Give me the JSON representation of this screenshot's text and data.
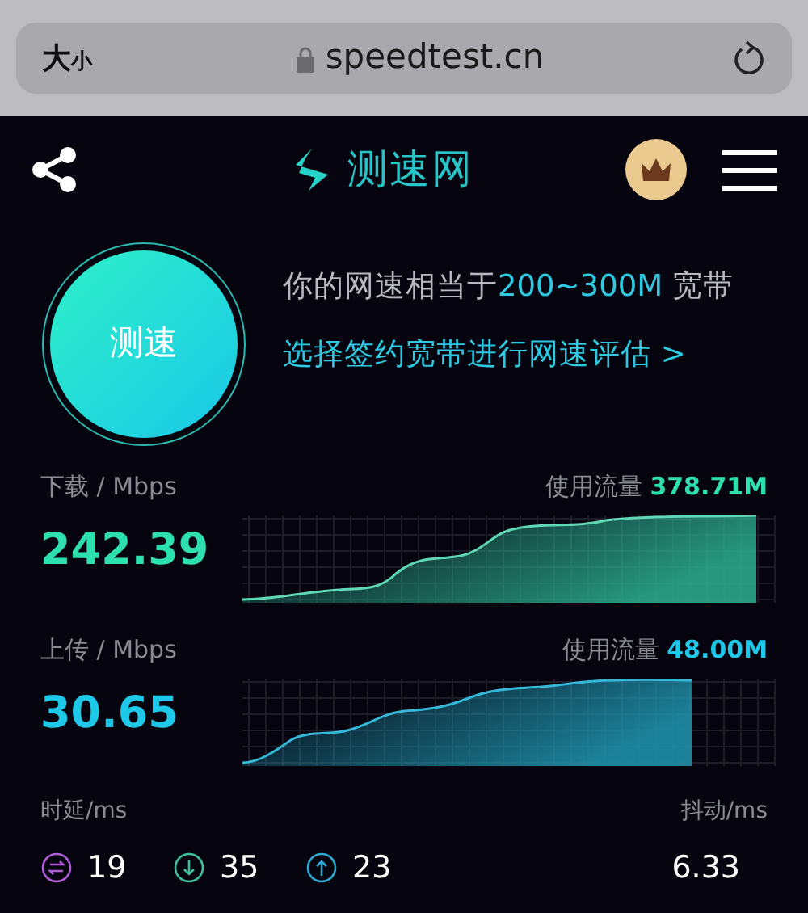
{
  "browser_bar": {
    "text_size": {
      "large": "大",
      "small": "小"
    },
    "url": "speedtest.cn"
  },
  "header": {
    "logo_text": "测速网"
  },
  "test_button": {
    "label": "测速"
  },
  "result": {
    "prefix": "你的网速相当于",
    "highlight": "200~300M",
    "suffix": "宽带",
    "link": "选择签约宽带进行网速评估 >"
  },
  "metrics": [
    {
      "kind": "download",
      "label": "下载 / Mbps",
      "value": "242.39",
      "traffic_label": "使用流量",
      "traffic": "378.71M"
    },
    {
      "kind": "upload",
      "label": "上传 / Mbps",
      "value": "30.65",
      "traffic_label": "使用流量",
      "traffic": "48.00M"
    }
  ],
  "latency": {
    "label": "时延/ms",
    "items": [
      {
        "kind": "idle",
        "value": "19",
        "color": "#b05cd8"
      },
      {
        "kind": "download",
        "value": "35",
        "color": "#3fc0a0"
      },
      {
        "kind": "upload",
        "value": "23",
        "color": "#2ea8d0"
      }
    ]
  },
  "jitter": {
    "label": "抖动/ms",
    "value": "6.33"
  }
}
